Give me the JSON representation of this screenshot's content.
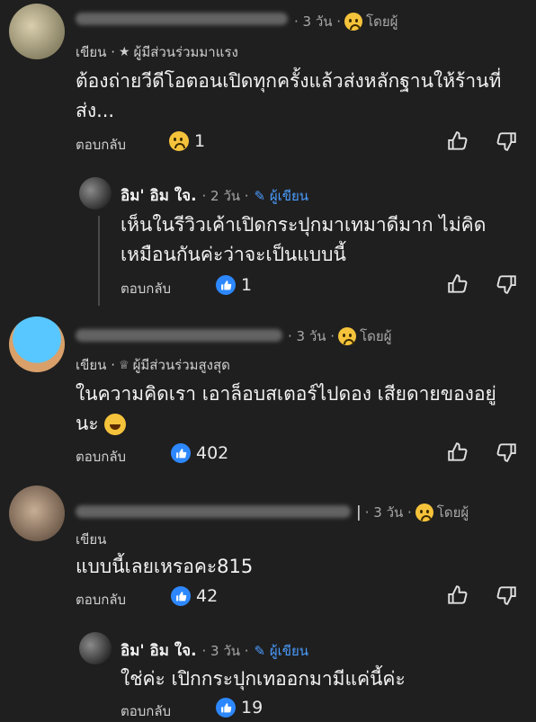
{
  "comments": [
    {
      "time": "· 3 วัน ·",
      "via": "โดยผู้",
      "role_prefix": "เขียน ·",
      "badge": "ผู้มีส่วนร่วมมาแรง",
      "text": "ต้องถ่ายวีดีโอตอนเปิดทุกครั้งแล้วส่งหลักฐานให้ร้านที่ส่ง...",
      "reply_label": "ตอบกลับ",
      "reaction_count": "1"
    },
    {
      "name": "อิม' อิม ใจ.",
      "time": "· 2 วัน ·",
      "author_label": "ผู้เขียน",
      "text": "เห็นในรีวิวเค้าเปิดกระปุกมาเทมาดีมาก ไม่คิดเหมือนกันค่ะว่าจะเป็นแบบนี้",
      "reply_label": "ตอบกลับ",
      "reaction_count": "1"
    },
    {
      "time": "· 3 วัน ·",
      "via": "โดยผู้",
      "role_prefix": "เขียน ·",
      "badge": "ผู้มีส่วนร่วมสูงสุด",
      "text": "ในความคิดเรา เอาล็อบสเตอร์ไปดอง เสียดายของอยู่นะ",
      "reply_label": "ตอบกลับ",
      "reaction_count": "402"
    },
    {
      "time": "· 3 วัน ·",
      "via": "โดยผู้",
      "role_prefix": "เขียน",
      "text": "แบบนี้เลยเหรอคะ815",
      "reply_label": "ตอบกลับ",
      "reaction_count": "42"
    },
    {
      "name": "อิม' อิม ใจ.",
      "time": "· 3 วัน ·",
      "author_label": "ผู้เขียน",
      "text": "ใช่ค่ะ เปิกกระปุกเทออกมามีแค่นี้ค่ะ",
      "reply_label": "ตอบกลับ",
      "reaction_count": "19"
    }
  ]
}
